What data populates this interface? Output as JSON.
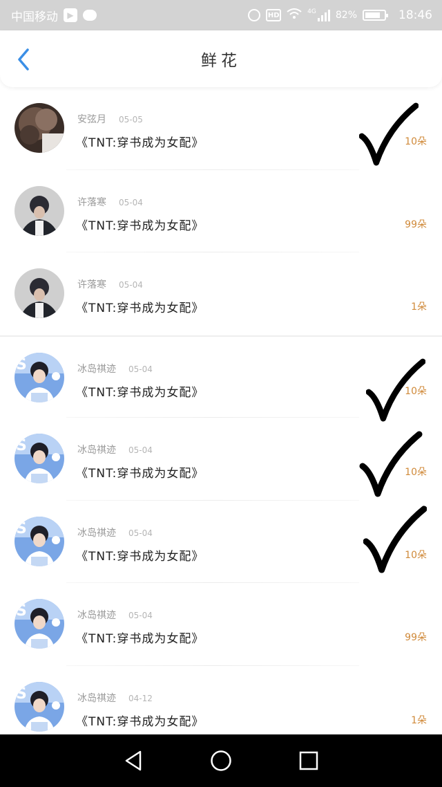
{
  "status_bar": {
    "carrier": "中国移动",
    "network": "4G",
    "battery": "82%",
    "battery_level": 0.82,
    "time": "18:46"
  },
  "header": {
    "title": "鲜花",
    "back_icon": "chevron-left-icon"
  },
  "colors": {
    "accent_blue": "#3b8fe6",
    "count_orange": "#d08a3a",
    "status_bar_bg": "#d3d3d3"
  },
  "items": [
    {
      "user": "安弦月",
      "date": "05-05",
      "book": "《TNT:穿书成为女配》",
      "count": "10朵",
      "checked": true
    },
    {
      "user": "许落寒",
      "date": "05-04",
      "book": "《TNT:穿书成为女配》",
      "count": "99朵",
      "checked": false
    },
    {
      "user": "许落寒",
      "date": "05-04",
      "book": "《TNT:穿书成为女配》",
      "count": "1朵",
      "checked": false
    },
    {
      "user": "冰岛祺迹",
      "date": "05-04",
      "book": "《TNT:穿书成为女配》",
      "count": "10朵",
      "checked": true
    },
    {
      "user": "冰岛祺迹",
      "date": "05-04",
      "book": "《TNT:穿书成为女配》",
      "count": "10朵",
      "checked": true
    },
    {
      "user": "冰岛祺迹",
      "date": "05-04",
      "book": "《TNT:穿书成为女配》",
      "count": "10朵",
      "checked": true
    },
    {
      "user": "冰岛祺迹",
      "date": "05-04",
      "book": "《TNT:穿书成为女配》",
      "count": "99朵",
      "checked": false
    },
    {
      "user": "冰岛祺迹",
      "date": "04-12",
      "book": "《TNT:穿书成为女配》",
      "count": "1朵",
      "checked": false
    }
  ],
  "nav_bar": {
    "back": "back-triangle-icon",
    "home": "home-circle-icon",
    "recents": "recents-square-icon"
  }
}
